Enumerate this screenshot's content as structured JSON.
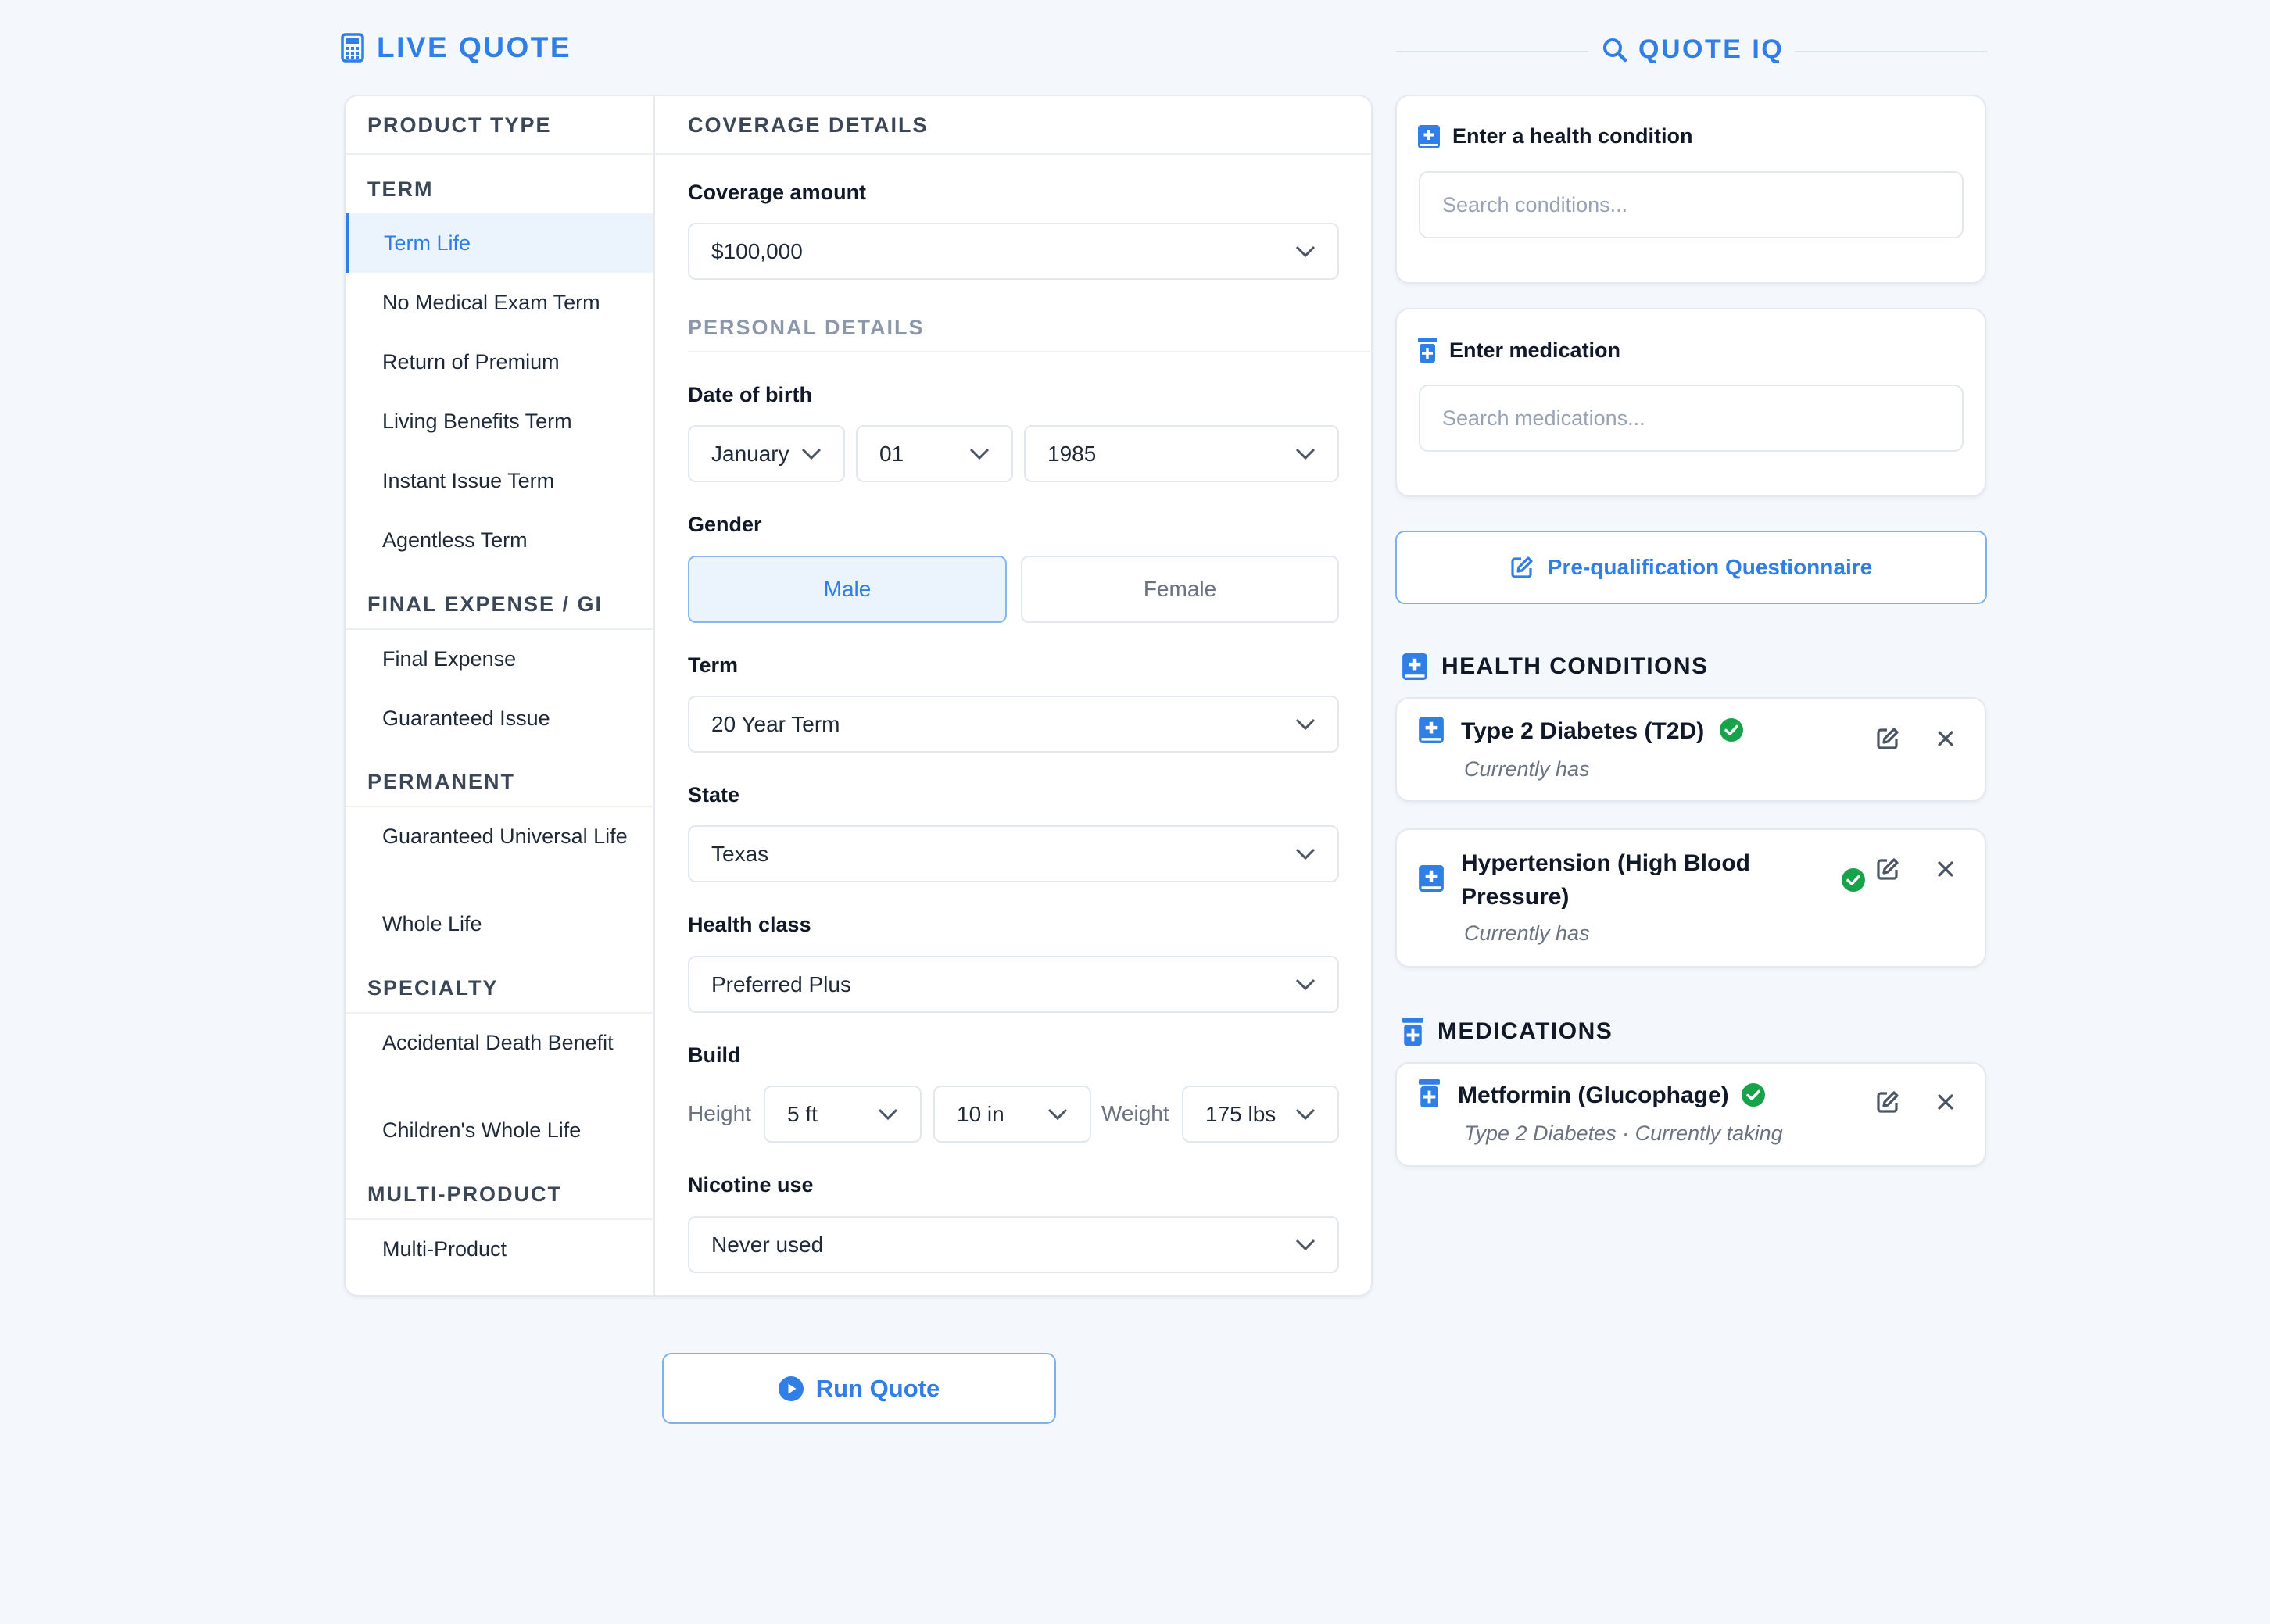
{
  "live_quote": {
    "title": "LIVE QUOTE"
  },
  "quote_iq": {
    "title": "QUOTE IQ"
  },
  "product_type": {
    "header": "PRODUCT TYPE",
    "groups": [
      {
        "label": "TERM",
        "items": [
          "Term Life",
          "No Medical Exam Term",
          "Return of Premium",
          "Living Benefits Term",
          "Instant Issue Term",
          "Agentless Term"
        ]
      },
      {
        "label": "FINAL EXPENSE / GI",
        "items": [
          "Final Expense",
          "Guaranteed Issue"
        ]
      },
      {
        "label": "PERMANENT",
        "items": [
          "Guaranteed Universal Life",
          "Whole Life"
        ]
      },
      {
        "label": "SPECIALTY",
        "items": [
          "Accidental Death Benefit",
          "Children's Whole Life"
        ]
      },
      {
        "label": "MULTI-PRODUCT",
        "items": [
          "Multi-Product"
        ]
      }
    ],
    "selected": "Term Life"
  },
  "coverage": {
    "header": "COVERAGE DETAILS",
    "amount_label": "Coverage amount",
    "amount_value": "$100,000"
  },
  "personal": {
    "header": "PERSONAL DETAILS",
    "dob_label": "Date of birth",
    "dob_month": "January",
    "dob_day": "01",
    "dob_year": "1985",
    "gender_label": "Gender",
    "gender_male": "Male",
    "gender_female": "Female",
    "gender_selected": "Male",
    "term_label": "Term",
    "term_value": "20 Year Term",
    "state_label": "State",
    "state_value": "Texas",
    "health_class_label": "Health class",
    "health_class_value": "Preferred Plus",
    "build_label": "Build",
    "height_label": "Height",
    "height_ft": "5 ft",
    "height_in": "10 in",
    "weight_label": "Weight",
    "weight_value": "175 lbs",
    "nicotine_label": "Nicotine use",
    "nicotine_value": "Never used"
  },
  "run_quote": {
    "label": "Run Quote"
  },
  "condition_search": {
    "title": "Enter a health condition",
    "placeholder": "Search conditions..."
  },
  "medication_search": {
    "title": "Enter medication",
    "placeholder": "Search medications..."
  },
  "prequal": {
    "label": "Pre-qualification Questionnaire"
  },
  "health_conditions": {
    "title": "HEALTH CONDITIONS",
    "items": [
      {
        "name": "Type 2 Diabetes (T2D)",
        "status": "Currently has"
      },
      {
        "name": "Hypertension (High Blood Pressure)",
        "status": "Currently has"
      }
    ]
  },
  "medications": {
    "title": "MEDICATIONS",
    "items": [
      {
        "name": "Metformin (Glucophage)",
        "detail": "Type 2 Diabetes · Currently taking"
      }
    ]
  },
  "icons": {
    "live_quote": "calculator-icon",
    "quote_iq": "search-icon",
    "condition": "medical-book-icon",
    "medication": "pill-bottle-icon",
    "prequal": "edit-icon",
    "verified": "check-circle-icon",
    "edit": "edit-icon",
    "remove": "close-icon",
    "run": "play-circle-icon",
    "dropdown": "chevron-down-icon"
  },
  "colors": {
    "accent": "#2f7fe6",
    "success": "#16a34a",
    "background": "#f4f7fb"
  }
}
